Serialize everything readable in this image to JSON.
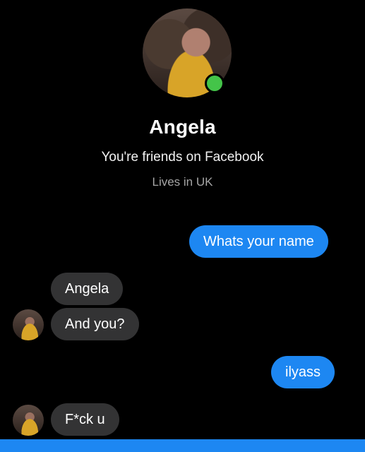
{
  "contact": {
    "name": "Angela",
    "friends_text": "You're friends on Facebook",
    "location_text": "Lives in UK",
    "online": true
  },
  "messages": [
    {
      "direction": "outgoing",
      "text": "Whats your name"
    },
    {
      "direction": "incoming",
      "text": "Angela"
    },
    {
      "direction": "incoming",
      "text": "And you?"
    },
    {
      "direction": "outgoing",
      "text": "ilyass"
    },
    {
      "direction": "incoming",
      "text": "F*ck u"
    }
  ],
  "colors": {
    "background": "#000000",
    "outgoing_bubble": "#1d87f2",
    "incoming_bubble": "#333334",
    "online_indicator": "#44c449"
  },
  "icons": {
    "profile_avatar": "profile-photo",
    "online_indicator": "green-dot"
  }
}
